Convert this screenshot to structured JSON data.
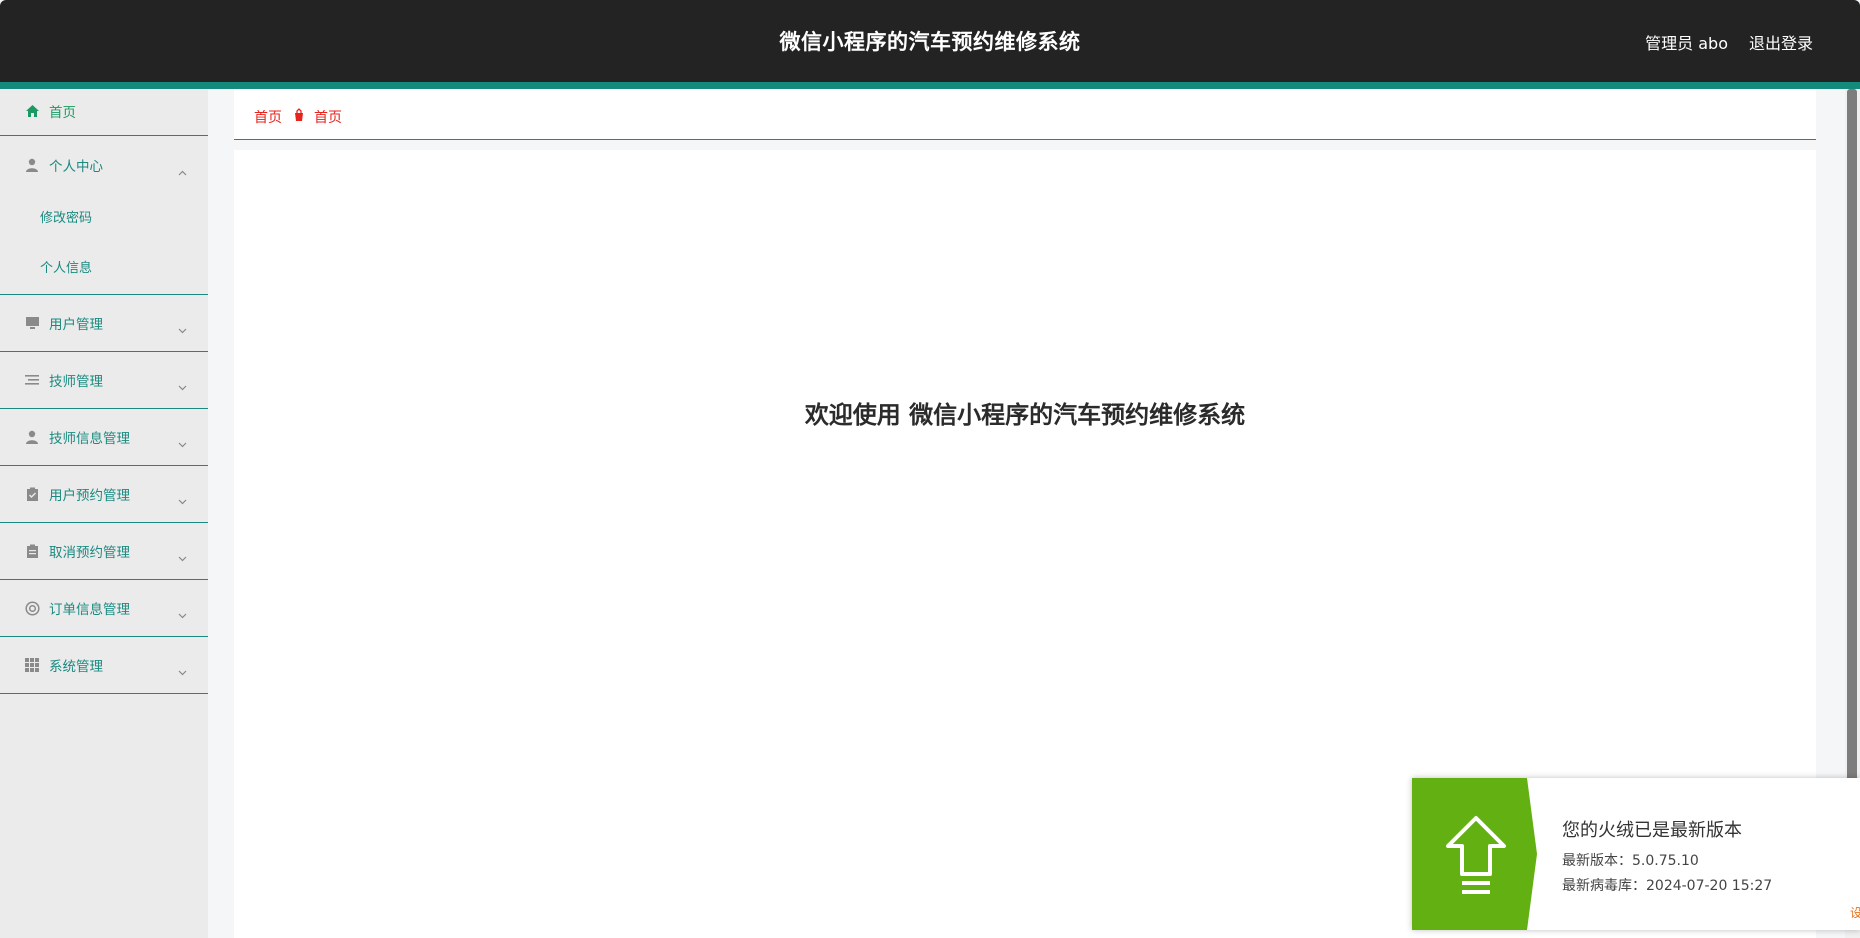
{
  "header": {
    "title": "微信小程序的汽车预约维修系统",
    "user": "管理员 abo",
    "logout": "退出登录"
  },
  "sidebar": {
    "home": "首页",
    "personal_center": {
      "label": "个人中心",
      "items": [
        "修改密码",
        "个人信息"
      ]
    },
    "items": [
      {
        "label": "用户管理",
        "icon": "monitor-icon"
      },
      {
        "label": "技师管理",
        "icon": "list-icon"
      },
      {
        "label": "技师信息管理",
        "icon": "user-icon"
      },
      {
        "label": "用户预约管理",
        "icon": "clipboard-check-icon"
      },
      {
        "label": "取消预约管理",
        "icon": "clipboard-icon"
      },
      {
        "label": "订单信息管理",
        "icon": "lifebuoy-icon"
      },
      {
        "label": "系统管理",
        "icon": "grid-icon"
      }
    ]
  },
  "breadcrumb": {
    "home": "首页",
    "current": "首页"
  },
  "main": {
    "welcome": "欢迎使用 微信小程序的汽车预约维修系统"
  },
  "notification": {
    "title": "您的火绒已是最新版本",
    "version": "最新版本：5.0.75.10",
    "virus_db": "最新病毒库：2024-07-20 15:27",
    "more": "设"
  },
  "colors": {
    "header_bg": "#232323",
    "accent": "#138a7b",
    "sidebar_bg": "#ebebeb",
    "breadcrumb_text": "#e8231c",
    "notify_green": "#62b012"
  }
}
